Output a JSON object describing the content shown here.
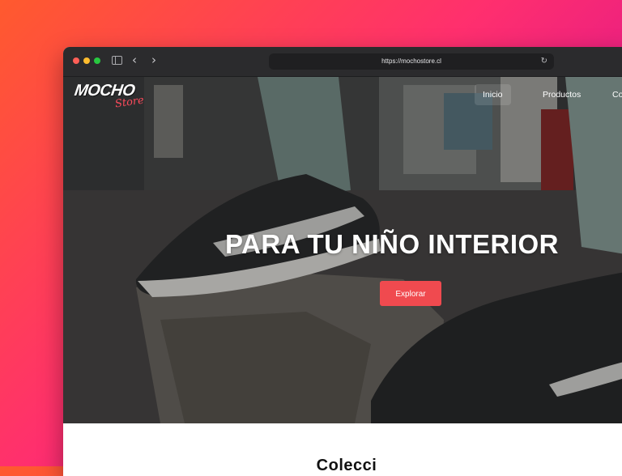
{
  "browser": {
    "url": "https://mochostore.cl"
  },
  "site": {
    "logo_main": "MOCHO",
    "logo_sub": "Store",
    "nav": [
      "Inicio",
      "Productos",
      "Co"
    ]
  },
  "hero": {
    "title": "PARA TU NIÑO INTERIOR",
    "cta_label": "Explorar"
  },
  "section": {
    "heading": "Colecci"
  },
  "colors": {
    "accent": "#f04a4f",
    "titlebar": "#2b2b2d"
  }
}
